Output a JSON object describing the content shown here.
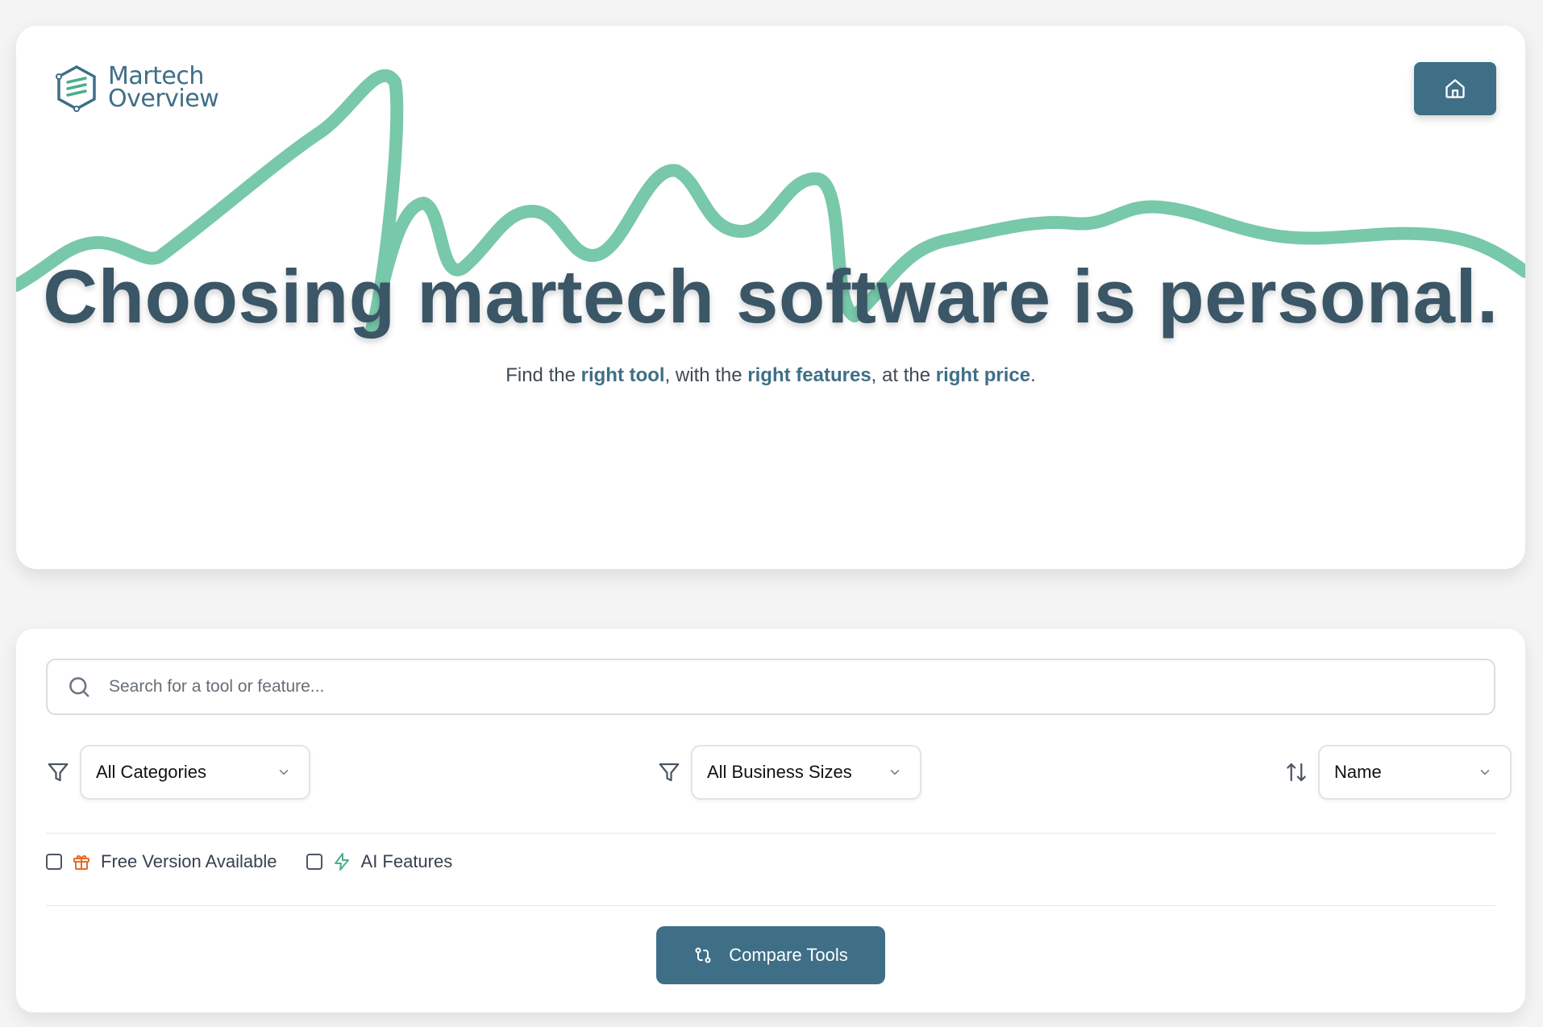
{
  "brand": {
    "name_line1": "Martech",
    "name_line2": "Overview",
    "accent_color": "#3f6f87",
    "wave_color": "#6cc3a3"
  },
  "header": {
    "home_icon": "home-icon"
  },
  "hero": {
    "headline": "Choosing martech software is personal.",
    "tagline": {
      "t1": "Find the ",
      "h1": "right tool",
      "t2": ", with the ",
      "h2": "right features",
      "t3": ", at the ",
      "h3": "right price",
      "t4": "."
    }
  },
  "search": {
    "placeholder": "Search for a tool or feature...",
    "value": "",
    "icon": "search-icon"
  },
  "filters": {
    "category": {
      "icon": "filter-icon",
      "selected": "All Categories"
    },
    "business_size": {
      "icon": "filter-icon",
      "selected": "All Business Sizes"
    },
    "sort": {
      "icon": "sort-icon",
      "selected": "Name"
    }
  },
  "toggles": [
    {
      "label": "Free Version Available",
      "icon": "gift-icon",
      "checked": false,
      "icon_color": "#ea6a24"
    },
    {
      "label": "AI Features",
      "icon": "lightning-icon",
      "checked": false,
      "icon_color": "#4cae8c"
    }
  ],
  "actions": {
    "compare_label": "Compare Tools",
    "compare_icon": "compare-icon"
  }
}
